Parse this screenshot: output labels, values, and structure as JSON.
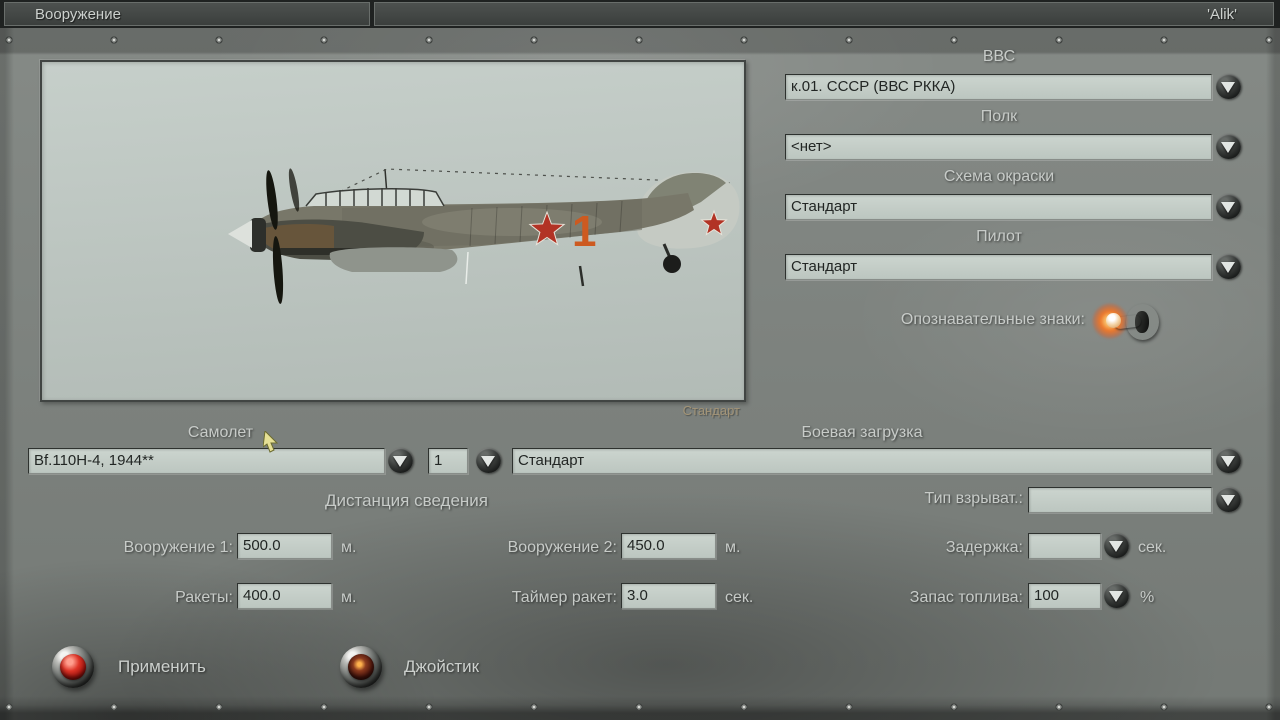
{
  "window": {
    "left_tab": "Вооружение",
    "right_tab": "'Alik'"
  },
  "preview": {
    "caption": "Стандарт",
    "marking_number": "1"
  },
  "squadron": {
    "vvs": {
      "label": "ВВС",
      "value": "к.01. СССР (ВВС РККА)"
    },
    "regiment": {
      "label": "Полк",
      "value": "<нет>"
    },
    "paint": {
      "label": "Схема окраски",
      "value": "Стандарт"
    },
    "pilot": {
      "label": "Пилот",
      "value": "Стандарт"
    },
    "markings": {
      "label": "Опознавательные знаки:",
      "state": "on"
    }
  },
  "aircraft": {
    "label": "Самолет",
    "value": "Bf.110H-4, 1944**",
    "count": "1",
    "loadout_label": "Боевая загрузка",
    "loadout_value": "Стандарт"
  },
  "settings": {
    "convergence_title": "Дистанция сведения",
    "weapon1": {
      "label": "Вооружение 1:",
      "value": "500.0",
      "unit": "м."
    },
    "weapon2": {
      "label": "Вооружение 2:",
      "value": "450.0",
      "unit": "м."
    },
    "rockets": {
      "label": "Ракеты:",
      "value": "400.0",
      "unit": "м."
    },
    "rocket_timer": {
      "label": "Таймер ракет:",
      "value": "3.0",
      "unit": "сек."
    },
    "fuse_type": {
      "label": "Тип взрыват.:",
      "value": ""
    },
    "delay": {
      "label": "Задержка:",
      "value": "",
      "unit": "сек."
    },
    "fuel": {
      "label": "Запас топлива:",
      "value": "100",
      "unit": "%"
    }
  },
  "actions": {
    "apply": "Применить",
    "joystick": "Джойстик"
  },
  "colors": {
    "panel": "#7d827e",
    "field_bg": "#c5cec8",
    "label_text": "#c7cbc8",
    "toggle_glow": "#ff7a1e",
    "star_red": "#b23325",
    "marking_orange": "#cd5a20"
  }
}
